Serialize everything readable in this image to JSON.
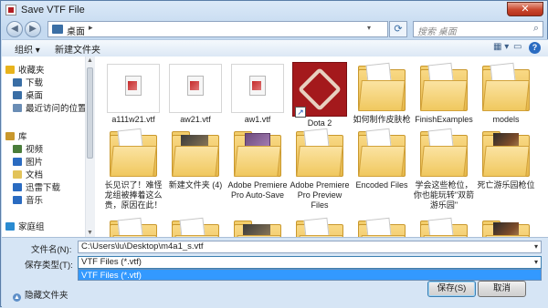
{
  "window": {
    "title": "Save VTF File",
    "close_glyph": "✕"
  },
  "address": {
    "crumb": "桌面",
    "arrow": "▸",
    "search_placeholder": "搜索 桌面"
  },
  "toolbar": {
    "organize": "组织 ▾",
    "new_folder": "新建文件夹",
    "view_glyph": "▦ ▾",
    "help": "?"
  },
  "sidebar": {
    "items": [
      {
        "label": "收藏夹",
        "icon": "star-icon",
        "color": "#e8b31c"
      },
      {
        "label": "下载",
        "icon": "download-folder-icon",
        "color": "#3a6ea5"
      },
      {
        "label": "桌面",
        "icon": "desktop-icon",
        "color": "#3a6ea5"
      },
      {
        "label": "最近访问的位置",
        "icon": "recent-places-icon",
        "color": "#6a8db5"
      },
      {
        "label": "库",
        "icon": "library-icon",
        "color": "#c9982d"
      },
      {
        "label": "视频",
        "icon": "video-icon",
        "color": "#4a7d3a"
      },
      {
        "label": "图片",
        "icon": "pictures-icon",
        "color": "#2a6bc1"
      },
      {
        "label": "文档",
        "icon": "documents-icon",
        "color": "#e2c35a"
      },
      {
        "label": "迅雷下载",
        "icon": "thunder-download-icon",
        "color": "#2a6bc1"
      },
      {
        "label": "音乐",
        "icon": "music-icon",
        "color": "#2a6bc1"
      },
      {
        "label": "家庭组",
        "icon": "homegroup-icon",
        "color": "#2a8bd1"
      }
    ]
  },
  "files": {
    "items": [
      {
        "name": "a111w21.vtf",
        "kind": "vtf"
      },
      {
        "name": "aw21.vtf",
        "kind": "vtf"
      },
      {
        "name": "aw1.vtf",
        "kind": "vtf"
      },
      {
        "name": "Dota 2",
        "kind": "shortcut"
      },
      {
        "name": "如何制作皮肤枪",
        "kind": "folder"
      },
      {
        "name": "FinishExamples",
        "kind": "folder"
      },
      {
        "name": "models",
        "kind": "folder"
      },
      {
        "name": "长见识了！难怪龙组被捧着这么贵，原因在此！",
        "kind": "folder"
      },
      {
        "name": "新建文件夹 (4)",
        "kind": "folder-image"
      },
      {
        "name": "Adobe Premiere Pro Auto-Save",
        "kind": "folder-premiere"
      },
      {
        "name": "Adobe Premiere Pro Preview Files",
        "kind": "folder"
      },
      {
        "name": "Encoded Files",
        "kind": "folder"
      },
      {
        "name": "学会这些枪位，你也能玩转\"双箭游乐园\"",
        "kind": "folder-doc"
      },
      {
        "name": "死亡游乐园枪位",
        "kind": "folder-image"
      }
    ]
  },
  "form": {
    "filename_label": "文件名(N):",
    "filename_value": "C:\\Users\\lu\\Desktop\\m4a1_s.vtf",
    "type_label": "保存类型(T):",
    "type_value": "VTF Files (*.vtf)",
    "dropdown_option": "VTF Files (*.vtf)",
    "hide_folders": "隐藏文件夹",
    "save": "保存(S)",
    "cancel": "取消"
  }
}
